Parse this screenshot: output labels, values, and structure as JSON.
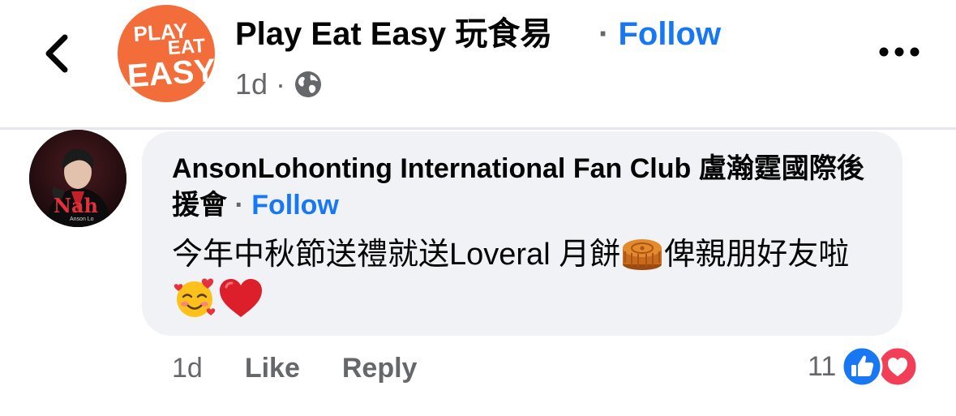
{
  "header": {
    "page_name": "Play Eat Easy 玩食易",
    "separator": "·",
    "follow_label": "Follow",
    "time": "1d",
    "meta_separator": "·",
    "audience_icon": "globe-icon",
    "back_icon": "chevron-left-icon",
    "more_icon": "more-horizontal-icon",
    "logo_text": [
      "PLAY",
      "EAT",
      "EASY"
    ]
  },
  "comment": {
    "author": "AnsonLohonting International Fan Club 盧瀚霆國際後援會",
    "separator": "·",
    "follow_label": "Follow",
    "text_part1": "今年中秋節送禮就送Loveral 月餅",
    "text_part2": "俾親朋好友啦",
    "emojis": [
      "mooncake",
      "smiling-face-with-hearts",
      "red-heart"
    ],
    "avatar_text": "Nah",
    "avatar_signature": "Anson Lo"
  },
  "actions": {
    "time": "1d",
    "like_label": "Like",
    "reply_label": "Reply"
  },
  "reactions": {
    "count": "11",
    "types": [
      "like",
      "love"
    ]
  },
  "colors": {
    "accent": "#1877f2",
    "secondary_text": "#65676b",
    "bubble_bg": "#f0f2f5",
    "logo_bg": "#f36d3b",
    "love_red": "#f33e58"
  }
}
